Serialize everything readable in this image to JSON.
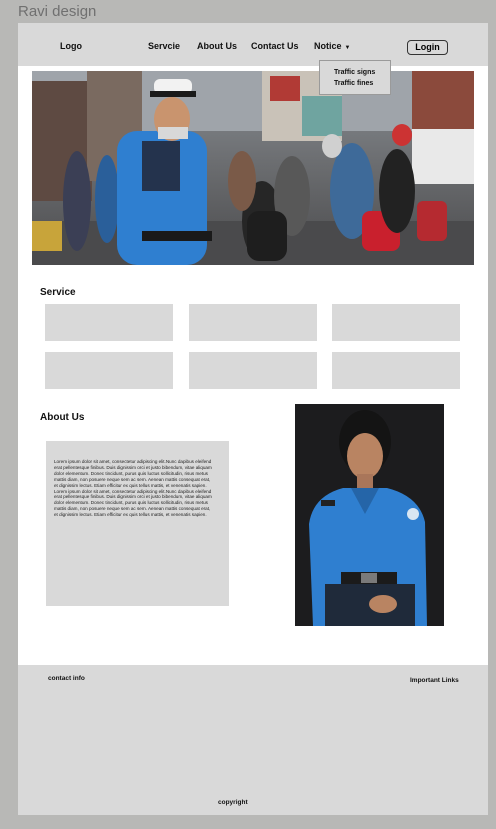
{
  "app_title": "Ravi design",
  "nav": {
    "logo": "Logo",
    "items": [
      "Servcie",
      "About Us",
      "Contact Us",
      "Notice"
    ],
    "login_label": "Login",
    "notice_dropdown": [
      "Traffic signs",
      "Traffic fines"
    ]
  },
  "service": {
    "title": "Service",
    "card_count": 6
  },
  "about": {
    "title": "About Us",
    "text": "Lorem ipsum dolor sit amet, consectetur adipiscing elit.Nunc dapibus eleifend\nerat pellentesque finibus. Duis dignissim orci et justo bibendum, vitae aliquam\ndolor elementum. Donec tincidunt, purus quis luctus sollicitudin, risus metus\nmattis diam, non posuere neque sem ac sem. Aenean mattis consequat erat,\net dignissim lectus. Etiam efficitur ex quis tellus mattis, et venenatis sapien.\nLorem ipsum dolor sit amet, consectetur adipiscing elit.Nunc dapibus eleifend\nerat pellentesque finibus. Duis dignissim orci et justo bibendum, vitae aliquam\ndolor elementum. Donec tincidunt, purus quis luctus sollicitudin, risus metus\nmattis diam, non posuere neque sem ac sem. Aenean mattis consequat erat,\net dignissim lectus. Etiam efficitur ex quis tellus mattis, et venenatis sapien."
  },
  "footer": {
    "contact_info": "contact info",
    "important_links": "Important Links",
    "copyright": "copyright"
  },
  "colors": {
    "canvas": "#b8b8b6",
    "panel": "#d9d9d9",
    "uniform_blue": "#2f7fd0"
  }
}
